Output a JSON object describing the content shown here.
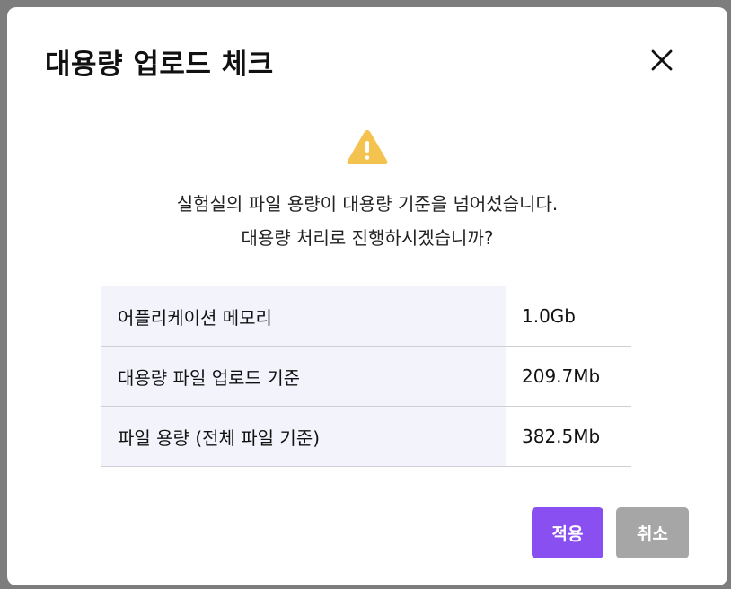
{
  "dialog": {
    "title": "대용량 업로드 체크",
    "message_line1": "실험실의 파일 용량이 대용량 기준을 넘어섰습니다.",
    "message_line2": "대용량 처리로 진행하시겠습니까?"
  },
  "info_rows": [
    {
      "label": "어플리케이션 메모리",
      "value": "1.0Gb"
    },
    {
      "label": "대용량 파일 업로드 기준",
      "value": "209.7Mb"
    },
    {
      "label": "파일 용량 (전체 파일 기준)",
      "value": "382.5Mb"
    }
  ],
  "buttons": {
    "apply_label": "적용",
    "cancel_label": "취소"
  },
  "icons": {
    "close": "close-icon",
    "warning": "warning-icon"
  },
  "colors": {
    "accent": "#8a4ff0",
    "cancel": "#a6a6a6",
    "warning": "#f4c24f",
    "label_bg": "#f3f3fb"
  }
}
